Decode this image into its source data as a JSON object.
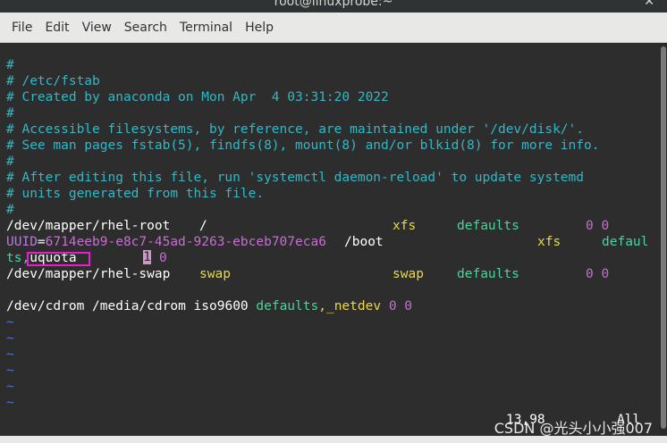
{
  "window": {
    "title": "root@linuxprobe:~",
    "close_glyph": "✕"
  },
  "menu": {
    "items": [
      "File",
      "Edit",
      "View",
      "Search",
      "Terminal",
      "Help"
    ]
  },
  "editor": {
    "comments": [
      "#",
      "# /etc/fstab",
      "# Created by anaconda on Mon Apr  4 03:31:20 2022",
      "#",
      "# Accessible filesystems, by reference, are maintained under '/dev/disk/'.",
      "# See man pages fstab(5), findfs(8), mount(8) and/or blkid(8) for more info.",
      "#",
      "# After editing this file, run 'systemctl daemon-reload' to update systemd",
      "# units generated from this file.",
      "#"
    ],
    "root_line": {
      "device": "/dev/mapper/rhel-root",
      "mount": "/",
      "fstype": "xfs",
      "options": "defaults",
      "dump_pass": "0 0"
    },
    "boot_line": {
      "uuid_key": "UUID",
      "uuid_eq": "=",
      "uuid_value": "6714eeb9-e8c7-45ad-9263-ebceb707eca6",
      "mount": "/boot",
      "fstype": "xfs",
      "options_part1": "defaul",
      "options_part2": "ts,",
      "options_uquota": "uquota",
      "cursor_char": "1",
      "pass": "0"
    },
    "swap_line": {
      "device": "/dev/mapper/rhel-swap",
      "mount": "swap",
      "fstype": "swap",
      "options": "defaults",
      "dump_pass": "0 0"
    },
    "cdrom_line": {
      "device": "/dev/cdrom",
      "mount": "/media/cdrom",
      "fstype": "iso9600",
      "options_a": "defaults",
      "options_b": ",_netdev",
      "dump_pass": "0 0"
    },
    "tilde": "~",
    "tilde_count": 6,
    "status_position": "13,98",
    "status_scroll": "All"
  },
  "watermark": "CSDN @光头小小强007",
  "colors": {
    "comment": "#2fb9c7",
    "keyword_yellow": "#e9d94b",
    "option_green": "#4fd19e",
    "number_magenta": "#c56fd0",
    "highlight_box": "#e91cd2"
  }
}
